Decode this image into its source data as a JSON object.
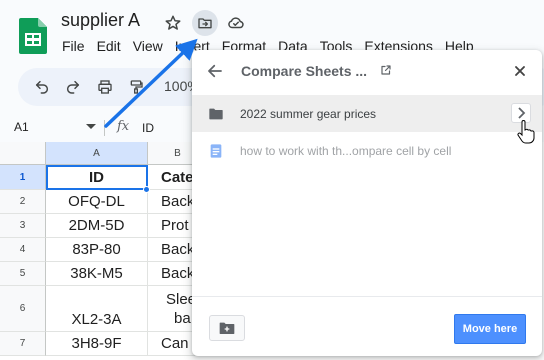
{
  "app": {
    "doc_title": "supplier A",
    "menu": [
      "File",
      "Edit",
      "View",
      "Insert",
      "Format",
      "Data",
      "Tools",
      "Extensions",
      "Help"
    ],
    "zoom": "100%"
  },
  "formula_bar": {
    "name_box": "A1",
    "fx_label": "fx",
    "value": "ID"
  },
  "grid": {
    "columns": [
      "A",
      "B"
    ],
    "rows": [
      {
        "num": "1",
        "a": "ID",
        "b": "Cate"
      },
      {
        "num": "2",
        "a": "OFQ-DL",
        "b": "Back"
      },
      {
        "num": "3",
        "a": "2DM-5D",
        "b": "Prot"
      },
      {
        "num": "4",
        "a": "83P-80",
        "b": "Back"
      },
      {
        "num": "5",
        "a": "38K-M5",
        "b": "Back"
      },
      {
        "num": "6",
        "a": "XL2-3A",
        "b": "Slee",
        "b2": "ba"
      },
      {
        "num": "7",
        "a": "3H8-9F",
        "b": "Can"
      }
    ]
  },
  "dialog": {
    "title": "Compare Sheets ...",
    "items": [
      {
        "label": "2022 summer gear prices",
        "type": "folder"
      },
      {
        "label": "how to work with th...ompare cell by cell",
        "type": "doc"
      }
    ],
    "move_here": "Move here"
  },
  "colors": {
    "accent": "#1a73e8",
    "move_btn": "#4d90fe",
    "sheets_green": "#0f9d58"
  }
}
